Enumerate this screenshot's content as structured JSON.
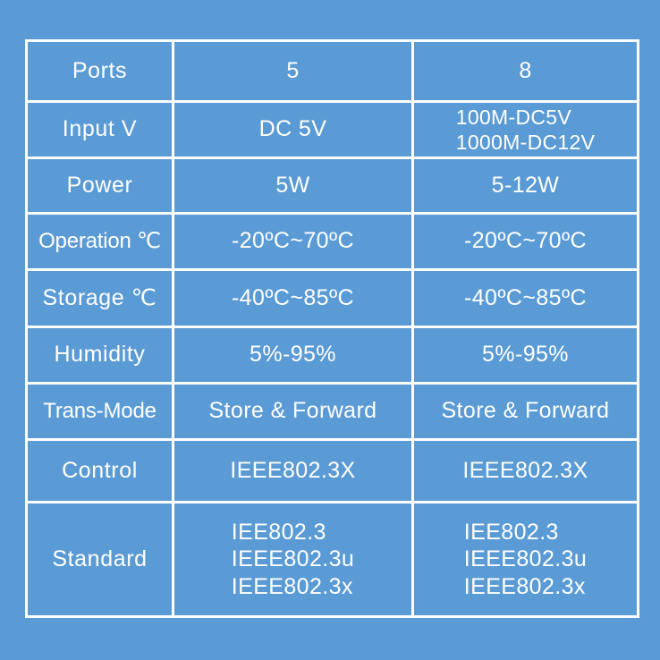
{
  "table": {
    "columns": [
      {
        "key": "label",
        "header": ""
      },
      {
        "key": "five",
        "header": "5"
      },
      {
        "key": "eight",
        "header": "8"
      }
    ],
    "colors": {
      "background": "#5b9bd5",
      "cell_fill": "#5b9bd5",
      "gridline": "#ffffff",
      "text": "#ffffff"
    },
    "rows": [
      {
        "name": "ports",
        "label": "Ports",
        "five": "5",
        "eight": "8"
      },
      {
        "name": "input-voltage",
        "label": "Input V",
        "five": "DC 5V",
        "eight_line1": "100M-DC5V",
        "eight_line2": "1000M-DC12V"
      },
      {
        "name": "power",
        "label": "Power",
        "five": "5W",
        "eight": "5-12W"
      },
      {
        "name": "operation-temperature",
        "label": "Operation ℃",
        "five": "-20ºC~70ºC",
        "eight": "-20ºC~70ºC"
      },
      {
        "name": "storage-temperature",
        "label": "Storage ℃",
        "five": "-40ºC~85ºC",
        "eight": "-40ºC~85ºC"
      },
      {
        "name": "humidity",
        "label": "Humidity",
        "five": "5%-95%",
        "eight": "5%-95%"
      },
      {
        "name": "transmission-mode",
        "label": "Trans-Mode",
        "five": "Store & Forward",
        "eight": "Store & Forward"
      },
      {
        "name": "flow-control",
        "label": "Control",
        "five": "IEEE802.3X",
        "eight": "IEEE802.3X"
      },
      {
        "name": "standard",
        "label": "Standard",
        "five_line1": "IEE802.3",
        "five_line2": "IEEE802.3u",
        "five_line3": "IEEE802.3x",
        "eight_line1": "IEE802.3",
        "eight_line2": "IEEE802.3u",
        "eight_line3": "IEEE802.3x"
      }
    ]
  }
}
